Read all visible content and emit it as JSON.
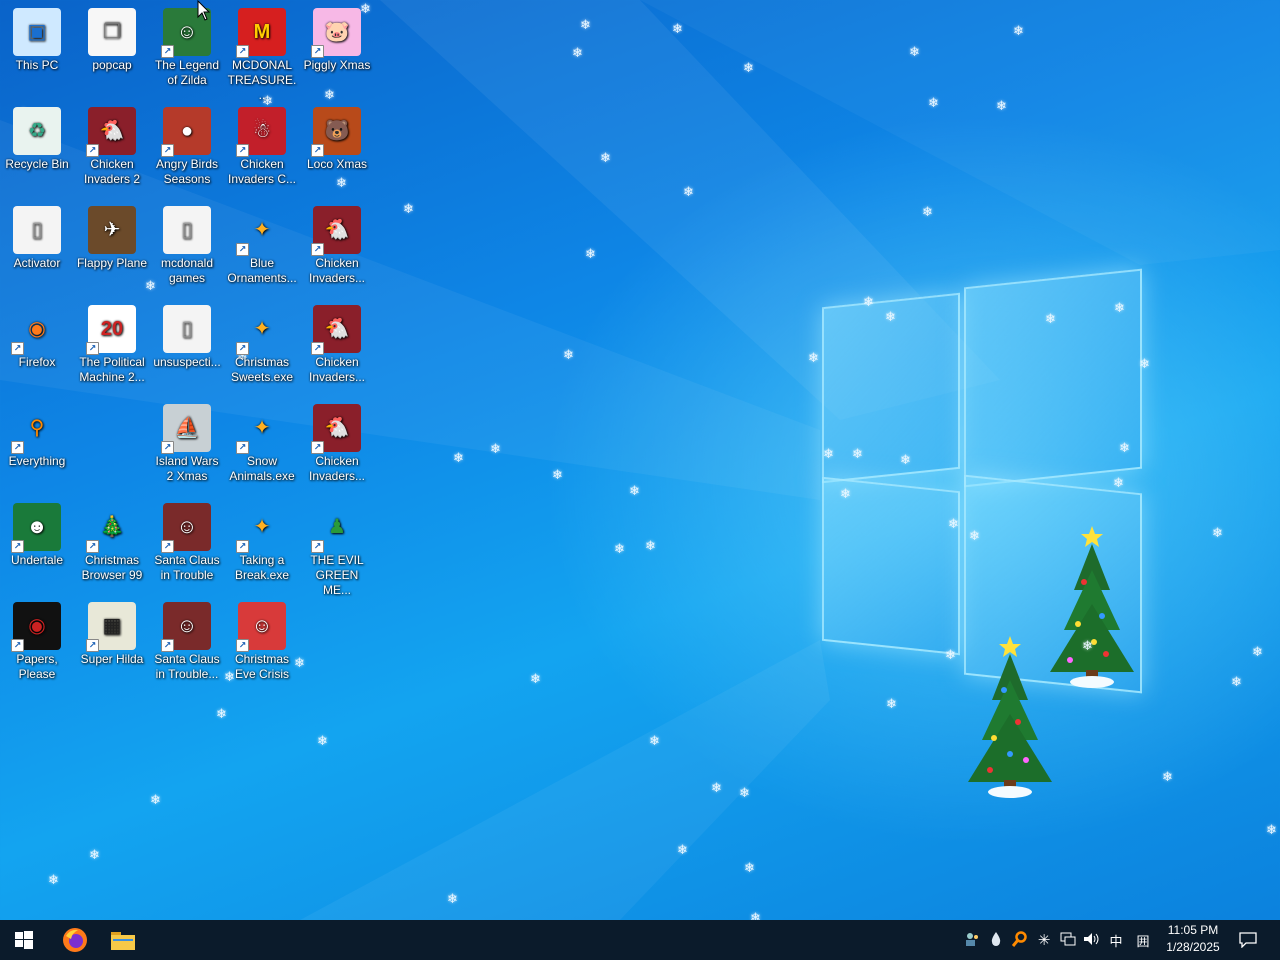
{
  "desktop": {
    "icons": [
      {
        "label": "This PC",
        "icon": "computer-icon",
        "shortcut": false
      },
      {
        "label": "popcap",
        "icon": "folder-icon",
        "shortcut": false
      },
      {
        "label": "The Legend of Zilda",
        "icon": "zilda-game-icon",
        "shortcut": true
      },
      {
        "label": "MCDONAL TREASURE...",
        "icon": "mcdonalds-icon",
        "shortcut": true
      },
      {
        "label": "Piggly Xmas",
        "icon": "piggly-icon",
        "shortcut": true
      },
      {
        "label": "Recycle Bin",
        "icon": "recycle-bin-icon",
        "shortcut": false
      },
      {
        "label": "Chicken Invaders 2",
        "icon": "chicken-invaders-icon",
        "shortcut": true
      },
      {
        "label": "Angry Birds Seasons",
        "icon": "angry-birds-icon",
        "shortcut": true
      },
      {
        "label": "Chicken Invaders C...",
        "icon": "chicken-invaders-christmas-icon",
        "shortcut": true
      },
      {
        "label": "Loco Xmas",
        "icon": "loco-xmas-icon",
        "shortcut": true
      },
      {
        "label": "Activator",
        "icon": "file-icon",
        "shortcut": false
      },
      {
        "label": "Flappy Plane",
        "icon": "flappy-plane-icon",
        "shortcut": false
      },
      {
        "label": "mcdonald games",
        "icon": "file-icon",
        "shortcut": false
      },
      {
        "label": "Blue Ornaments...",
        "icon": "puzzle-exe-icon",
        "shortcut": true
      },
      {
        "label": "Chicken Invaders...",
        "icon": "chicken-invaders-icon",
        "shortcut": true
      },
      {
        "label": "Firefox",
        "icon": "firefox-icon",
        "shortcut": true
      },
      {
        "label": "The Political Machine 2...",
        "icon": "political-machine-icon",
        "shortcut": true
      },
      {
        "label": "unsuspecti...",
        "icon": "file-icon",
        "shortcut": false
      },
      {
        "label": "Christmas Sweets.exe",
        "icon": "puzzle-exe-icon",
        "shortcut": true
      },
      {
        "label": "Chicken Invaders...",
        "icon": "chicken-invaders-icon",
        "shortcut": true
      },
      {
        "label": "Everything",
        "icon": "everything-search-icon",
        "shortcut": true
      },
      {
        "label": "Island Wars 2 Xmas",
        "icon": "island-wars-icon",
        "shortcut": true
      },
      {
        "label": "Snow Animals.exe",
        "icon": "puzzle-exe-icon",
        "shortcut": true
      },
      {
        "label": "Chicken Invaders...",
        "icon": "chicken-invaders-icon",
        "shortcut": true
      },
      {
        "label": "Undertale",
        "icon": "undertale-icon",
        "shortcut": true
      },
      {
        "label": "Christmas Browser 99",
        "icon": "christmas-tree-icon",
        "shortcut": true
      },
      {
        "label": "Santa Claus in Trouble",
        "icon": "santa-icon",
        "shortcut": true
      },
      {
        "label": "Taking a Break.exe",
        "icon": "puzzle-exe-icon",
        "shortcut": true
      },
      {
        "label": "THE EVIL GREEN ME...",
        "icon": "messenger-icon",
        "shortcut": true
      },
      {
        "label": "Papers, Please",
        "icon": "papers-please-icon",
        "shortcut": true
      },
      {
        "label": "Super Hilda",
        "icon": "super-hilda-icon",
        "shortcut": true
      },
      {
        "label": "Santa Claus in Trouble...",
        "icon": "santa-icon",
        "shortcut": true
      },
      {
        "label": "Christmas Eve Crisis",
        "icon": "santa-face-icon",
        "shortcut": true
      }
    ]
  },
  "taskbar": {
    "pinned": [
      {
        "name": "start",
        "icon": "windows-start-icon"
      },
      {
        "name": "firefox",
        "icon": "firefox-icon"
      },
      {
        "name": "file-explorer",
        "icon": "folder-icon"
      }
    ],
    "tray": {
      "icons": [
        "people-icon",
        "droplet-icon",
        "search-tray-icon",
        "snowflake-icon",
        "network-icon",
        "volume-icon"
      ],
      "ime_label": "中",
      "ime_grid": "囲"
    },
    "clock": {
      "time": "11:05 PM",
      "date": "1/28/2025"
    },
    "notification_icon": "notification-icon"
  },
  "colors": {
    "accent": "#0e86e6",
    "taskbar": "#0b1b2b"
  }
}
